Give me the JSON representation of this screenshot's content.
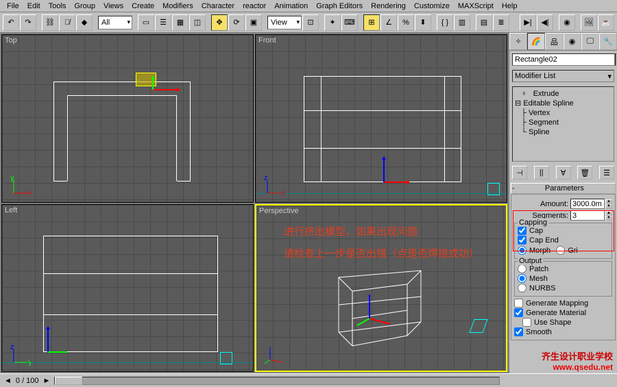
{
  "menu": {
    "items": [
      "File",
      "Edit",
      "Tools",
      "Group",
      "Views",
      "Create",
      "Modifiers",
      "Character",
      "reactor",
      "Animation",
      "Graph Editors",
      "Rendering",
      "Customize",
      "MAXScript",
      "Help"
    ]
  },
  "toolbar": {
    "set_combo": "All",
    "view_combo": "View"
  },
  "viewports": {
    "top": "Top",
    "front": "Front",
    "left": "Left",
    "persp": "Perspective"
  },
  "cmd": {
    "object_name": "Rectangle02",
    "mod_list_label": "Modifier List",
    "stack": {
      "extrude": "Extrude",
      "editable": "Editable Spline",
      "vertex": "Vertex",
      "segment": "Segment",
      "spline": "Spline"
    }
  },
  "params": {
    "header": "Parameters",
    "amount_label": "Amount:",
    "amount_value": "3000.0m",
    "segments_label": "Segments:",
    "segments_value": "3",
    "capping": "Capping",
    "cap_start": "Cap",
    "cap_end": "Cap End",
    "morph": "Morph",
    "grid": "Gri",
    "output": "Output",
    "patch": "Patch",
    "mesh": "Mesh",
    "nurbs": "NURBS",
    "gen_mapping": "Generate Mapping",
    "gen_material": "Generate Material",
    "use_shape": "Use Shape",
    "smooth": "Smooth"
  },
  "annotation": {
    "line1": "进行挤出模型，如果出现问题",
    "line2": "请检查上一步是否出错（点是否焊接成功）"
  },
  "status": {
    "frame": "0  /  100"
  },
  "watermark": {
    "l1": "齐生设计职业学校",
    "l2": "www.qsedu.net"
  }
}
